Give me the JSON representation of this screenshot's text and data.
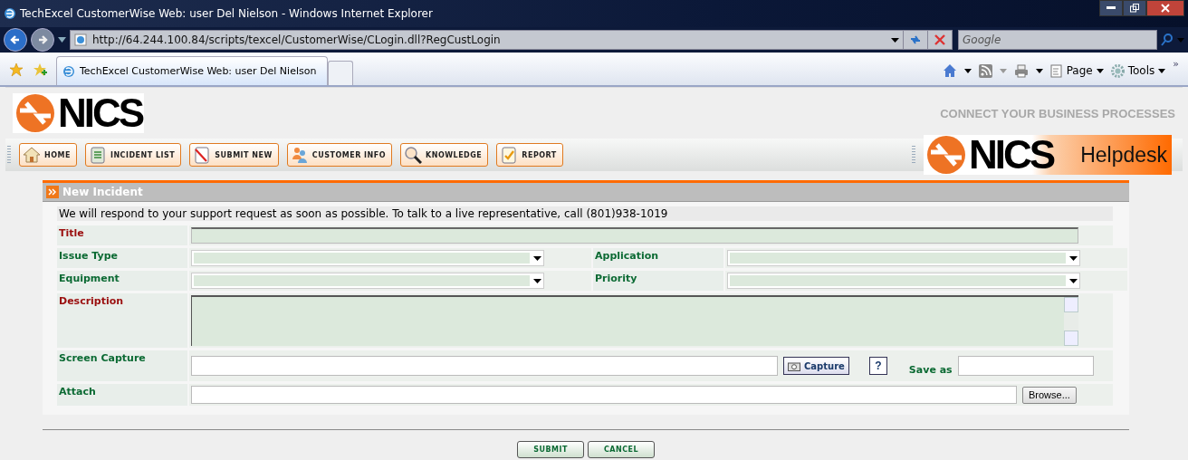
{
  "window": {
    "title": "TechExcel CustomerWise Web: user Del Nielson - Windows Internet Explorer"
  },
  "address_bar": {
    "url": "http://64.244.100.84/scripts/texcel/CustomerWise/CLogin.dll?RegCustLogin"
  },
  "search": {
    "placeholder": "Google"
  },
  "tabs": [
    {
      "label": "TechExcel CustomerWise Web: user Del Nielson",
      "selected": true
    }
  ],
  "command_bar": {
    "page": "Page",
    "tools": "Tools",
    "overflow": "»"
  },
  "site": {
    "logo": "NICS",
    "tagline": "CONNECT YOUR BUSINESS PROCESSES",
    "nav": [
      {
        "label": "HOME",
        "kind": "home"
      },
      {
        "label": "INCIDENT LIST",
        "kind": "list"
      },
      {
        "label": "SUBMIT NEW",
        "kind": "submit"
      },
      {
        "label": "CUSTOMER INFO",
        "kind": "people"
      },
      {
        "label": "KNOWLEDGE",
        "kind": "search"
      },
      {
        "label": "REPORT",
        "kind": "report"
      }
    ],
    "brand": {
      "name": "NICS",
      "product": "Helpdesk"
    }
  },
  "form": {
    "title": "New Incident",
    "notice": "We will respond to your support request as soon as possible. To talk to a live representative, call (801)938-1019",
    "rows": [
      {
        "kind": "text",
        "fields": [
          {
            "label": "Title",
            "required": true
          }
        ]
      },
      {
        "kind": "select",
        "fields": [
          {
            "label": "Issue Type",
            "required": false
          },
          {
            "label": "Application",
            "required": false
          }
        ]
      },
      {
        "kind": "select",
        "fields": [
          {
            "label": "Equipment",
            "required": false
          },
          {
            "label": "Priority",
            "required": false
          }
        ]
      },
      {
        "kind": "textarea",
        "fields": [
          {
            "label": "Description",
            "required": true
          }
        ]
      },
      {
        "kind": "capture",
        "fields": [
          {
            "label": "Screen Capture",
            "required": false
          }
        ],
        "capture_button": "Capture",
        "help_button": "?",
        "save_as_label": "Save as"
      },
      {
        "kind": "file",
        "fields": [
          {
            "label": "Attach",
            "required": false
          }
        ],
        "browse_button": "Browse..."
      }
    ],
    "buttons": [
      {
        "label": "SUBMIT"
      },
      {
        "label": "CANCEL"
      }
    ]
  }
}
